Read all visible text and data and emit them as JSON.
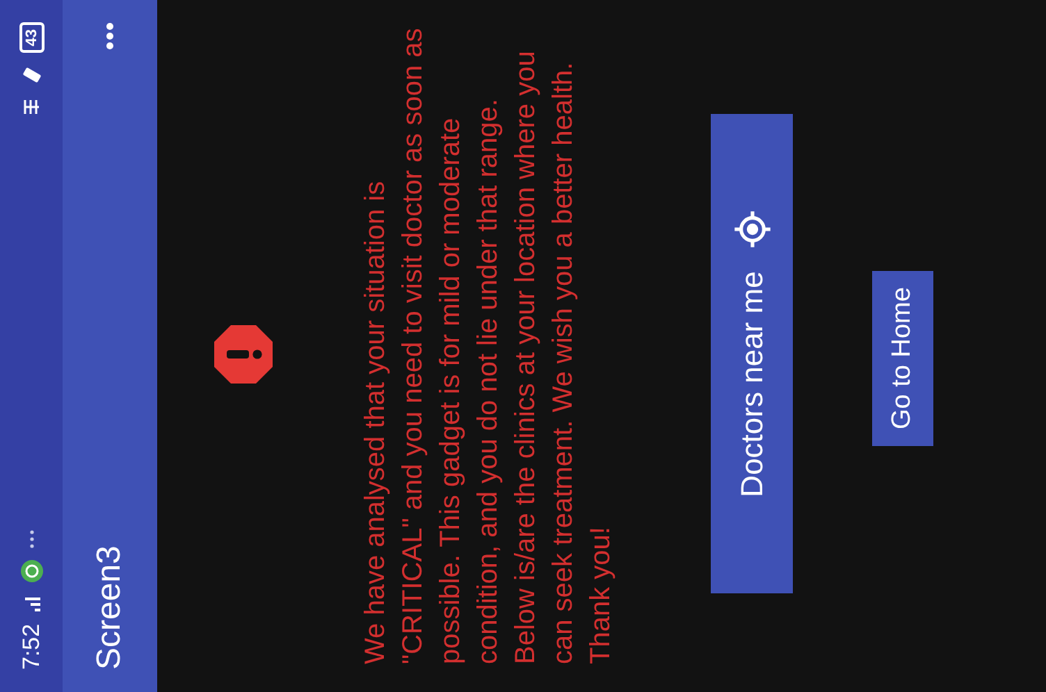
{
  "status_bar": {
    "time": "7:52",
    "battery": "43"
  },
  "app_bar": {
    "title": "Screen3"
  },
  "message": "We have analysed that your situation is \"CRITICAL\" and you need to visit doctor as soon as possible. This gadget is for mild or moderate condition, and you do not lie under that range. Below is/are the clinics at your location where you can seek treatment. We wish you a better health. Thank you!",
  "buttons": [
    {
      "label": "Doctors near me",
      "kind": "location"
    },
    {
      "label": "Go to Home",
      "kind": "plain"
    }
  ]
}
